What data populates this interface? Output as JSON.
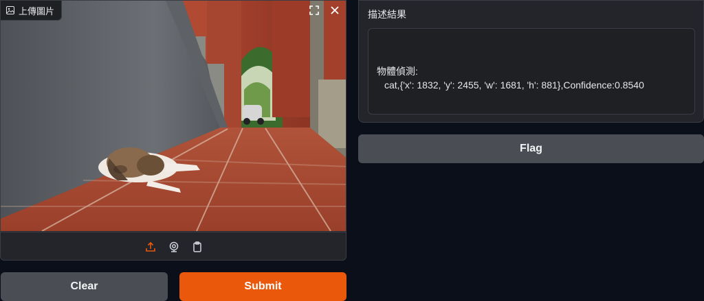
{
  "image_input": {
    "label": "上傳圖片",
    "label_icon": "image-icon",
    "actions": [
      "fullscreen-icon",
      "close-icon"
    ],
    "sources": [
      "upload-icon",
      "webcam-icon",
      "clipboard-icon"
    ],
    "active_source_color": "#ea580c"
  },
  "buttons": {
    "clear": "Clear",
    "submit": "Submit",
    "flag": "Flag"
  },
  "output": {
    "label": "描述結果",
    "heading": "物體偵測:",
    "result": "cat,{'x': 1832, 'y': 2455, 'w': 1681, 'h': 881},Confidence:0.8540"
  },
  "colors": {
    "accent": "#ea580c",
    "background": "#0b0f19",
    "panel": "#24252a"
  }
}
